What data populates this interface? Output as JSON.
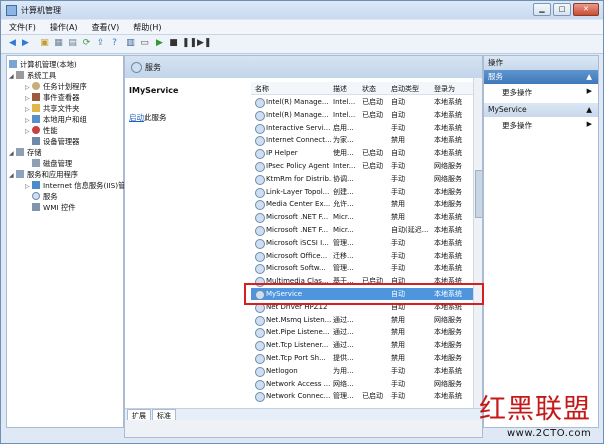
{
  "window": {
    "title": "计算机管理"
  },
  "menu": [
    "文件(F)",
    "操作(A)",
    "查看(V)",
    "帮助(H)"
  ],
  "tree": [
    {
      "label": "计算机管理(本地)",
      "icon": "computer-icon",
      "level": 0,
      "expander": ""
    },
    {
      "label": "系统工具",
      "icon": "tools-icon",
      "level": 1,
      "expander": "◢"
    },
    {
      "label": "任务计划程序",
      "icon": "clock-icon",
      "level": 2,
      "expander": "▷"
    },
    {
      "label": "事件查看器",
      "icon": "event-log-icon",
      "level": 2,
      "expander": "▷"
    },
    {
      "label": "共享文件夹",
      "icon": "folder-icon",
      "level": 2,
      "expander": "▷"
    },
    {
      "label": "本地用户和组",
      "icon": "users-icon",
      "level": 2,
      "expander": "▷"
    },
    {
      "label": "性能",
      "icon": "performance-icon",
      "level": 2,
      "expander": "▷"
    },
    {
      "label": "设备管理器",
      "icon": "device-icon",
      "level": 2,
      "expander": ""
    },
    {
      "label": "存储",
      "icon": "storage-icon",
      "level": 1,
      "expander": "◢"
    },
    {
      "label": "磁盘管理",
      "icon": "disk-icon",
      "level": 2,
      "expander": ""
    },
    {
      "label": "服务和应用程序",
      "icon": "services-apps-icon",
      "level": 1,
      "expander": "◢"
    },
    {
      "label": "Internet 信息服务(IIS)管",
      "icon": "iis-icon",
      "level": 2,
      "expander": "▷"
    },
    {
      "label": "服务",
      "icon": "gear-icon",
      "level": 2,
      "expander": ""
    },
    {
      "label": "WMI 控件",
      "icon": "wmi-icon",
      "level": 2,
      "expander": ""
    }
  ],
  "panel": {
    "title": "服务"
  },
  "left_info": {
    "service_name": "IMyService",
    "link": "启动",
    "link_suffix": "此服务"
  },
  "columns": {
    "name": "名称",
    "desc": "描述",
    "status": "状态",
    "startup": "启动类型",
    "logon": "登录为"
  },
  "services": [
    {
      "name": "Intel(R) Manage...",
      "desc": "Intel...",
      "status": "已启动",
      "startup": "自动",
      "logon": "本地系统"
    },
    {
      "name": "Intel(R) Manage...",
      "desc": "Intel...",
      "status": "已启动",
      "startup": "自动",
      "logon": "本地系统"
    },
    {
      "name": "Interactive Servi...",
      "desc": "启用...",
      "status": "",
      "startup": "手动",
      "logon": "本地系统"
    },
    {
      "name": "Internet Connect...",
      "desc": "为家...",
      "status": "",
      "startup": "禁用",
      "logon": "本地系统"
    },
    {
      "name": "IP Helper",
      "desc": "使用...",
      "status": "已启动",
      "startup": "自动",
      "logon": "本地系统"
    },
    {
      "name": "IPsec Policy Agent",
      "desc": "Inter...",
      "status": "已启动",
      "startup": "手动",
      "logon": "网络服务"
    },
    {
      "name": "KtmRm for Distrib...",
      "desc": "协调...",
      "status": "",
      "startup": "手动",
      "logon": "网络服务"
    },
    {
      "name": "Link-Layer Topol...",
      "desc": "创建...",
      "status": "",
      "startup": "手动",
      "logon": "本地服务"
    },
    {
      "name": "Media Center Ex...",
      "desc": "允许...",
      "status": "",
      "startup": "禁用",
      "logon": "本地服务"
    },
    {
      "name": "Microsoft .NET F...",
      "desc": "Micr...",
      "status": "",
      "startup": "禁用",
      "logon": "本地系统"
    },
    {
      "name": "Microsoft .NET F...",
      "desc": "Micr...",
      "status": "",
      "startup": "自动(延迟...",
      "logon": "本地系统"
    },
    {
      "name": "Microsoft iSCSI I...",
      "desc": "管理...",
      "status": "",
      "startup": "手动",
      "logon": "本地系统"
    },
    {
      "name": "Microsoft Office...",
      "desc": "迁移...",
      "status": "",
      "startup": "手动",
      "logon": "本地系统"
    },
    {
      "name": "Microsoft Softw...",
      "desc": "管理...",
      "status": "",
      "startup": "手动",
      "logon": "本地系统"
    },
    {
      "name": "Multimedia Clas...",
      "desc": "基于...",
      "status": "已启动",
      "startup": "自动",
      "logon": "本地系统"
    },
    {
      "name": "MyService",
      "desc": "",
      "status": "",
      "startup": "自动",
      "logon": "本地系统"
    },
    {
      "name": "Net Driver HPZ12",
      "desc": "",
      "status": "",
      "startup": "自动",
      "logon": "本地系统"
    },
    {
      "name": "Net.Msmq Listen...",
      "desc": "通过...",
      "status": "",
      "startup": "禁用",
      "logon": "网络服务"
    },
    {
      "name": "Net.Pipe Listene...",
      "desc": "通过...",
      "status": "",
      "startup": "禁用",
      "logon": "本地服务"
    },
    {
      "name": "Net.Tcp Listener...",
      "desc": "通过...",
      "status": "",
      "startup": "禁用",
      "logon": "本地服务"
    },
    {
      "name": "Net.Tcp Port Sh...",
      "desc": "提供...",
      "status": "",
      "startup": "禁用",
      "logon": "本地服务"
    },
    {
      "name": "Netlogon",
      "desc": "为用...",
      "status": "",
      "startup": "手动",
      "logon": "本地系统"
    },
    {
      "name": "Network Access ...",
      "desc": "网络...",
      "status": "",
      "startup": "手动",
      "logon": "网络服务"
    },
    {
      "name": "Network Connec...",
      "desc": "管理...",
      "status": "已启动",
      "startup": "手动",
      "logon": "本地系统"
    }
  ],
  "selected_index": 15,
  "bottom_tabs": [
    "扩展",
    "标准"
  ],
  "actions": {
    "header": "操作",
    "section1": "服务",
    "section1_more": "更多操作",
    "section2": "MyService",
    "section2_more": "更多操作"
  },
  "watermark": {
    "text": "红黑联盟",
    "url": "www.2CTO.com"
  },
  "colors": {
    "selection": "#4f95de",
    "highlight_box": "#d62020",
    "watermark_text": "#c51818"
  }
}
